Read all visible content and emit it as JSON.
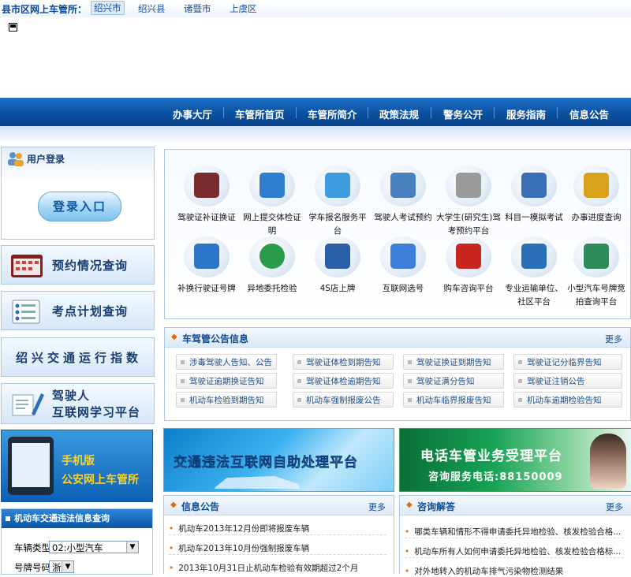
{
  "topbar": {
    "title": "县市区网上车管所：",
    "cities": [
      "绍兴市",
      "绍兴县",
      "诸暨市",
      "上虞区"
    ]
  },
  "nav": {
    "items": [
      "办事大厅",
      "车管所首页",
      "车管所简介",
      "政策法规",
      "警务公开",
      "服务指南",
      "信息公告"
    ]
  },
  "login": {
    "heading": "用户登录",
    "button": "登录入口"
  },
  "side_buttons": {
    "appointment": "预约情况查询",
    "exam_plan": "考点计划查询",
    "traffic_index": "绍兴交通运行指数",
    "learning_line1": "驾驶人",
    "learning_line2": "互联网学习平台"
  },
  "mobile": {
    "line1": "手机版",
    "line2": "公安网上车管所"
  },
  "violation": {
    "heading": "机动车交通违法信息查询",
    "type_label": "车辆类型",
    "type_value": "02:小型汽车",
    "plate_label": "号牌号码",
    "plate_value": "浙"
  },
  "services": [
    {
      "label": "驾驶证补证换证",
      "icon": "license-card-icon",
      "color": "#7a2b2b"
    },
    {
      "label": "网上提交体检证明",
      "icon": "documents-icon",
      "color": "#2f7fd0"
    },
    {
      "label": "学车报名服务平台",
      "icon": "pen-form-icon",
      "color": "#3f9be0"
    },
    {
      "label": "驾驶人考试预约",
      "icon": "monitor-icon",
      "color": "#4a7fc0"
    },
    {
      "label": "大学生(研究生)驾考预约平台",
      "icon": "book-icon",
      "color": "#9a9a9a"
    },
    {
      "label": "科目一模拟考试",
      "icon": "laptop-icon",
      "color": "#3a6fb5"
    },
    {
      "label": "办事进度查询",
      "icon": "folder-icon",
      "color": "#d9a21b"
    },
    {
      "label": "补换行驶证号牌",
      "icon": "blue-folder-icon",
      "color": "#2c76c9"
    },
    {
      "label": "异地委托检验",
      "icon": "globe-icon",
      "color": "#2a9b4a"
    },
    {
      "label": "4S店上牌",
      "icon": "calendar-icon",
      "color": "#2a5fa8"
    },
    {
      "label": "互联网选号",
      "icon": "palette-icon",
      "color": "#3c7fd8"
    },
    {
      "label": "购车咨询平台",
      "icon": "car-icon",
      "color": "#c8261f"
    },
    {
      "label": "专业运输单位、社区平台",
      "icon": "computer-icon",
      "color": "#2b6fb8"
    },
    {
      "label": "小型汽车号牌竞拍查询平台",
      "icon": "network-icon",
      "color": "#2f8a5a"
    }
  ],
  "notices": {
    "heading": "车驾管公告信息",
    "more": "更多",
    "tags": [
      "涉毒驾驶人告知、公告",
      "驾驶证体检到期告知",
      "驾驶证换证到期告知",
      "驾驶证记分临界告知",
      "驾驶证逾期换证告知",
      "驾驶证体检逾期告知",
      "驾驶证满分告知",
      "驾驶证注销公告",
      "机动车检验到期告知",
      "机动车强制报废公告",
      "机动车临界报废告知",
      "机动车逾期检验告知"
    ]
  },
  "banners": {
    "self_service": "交通违法互联网自助处理平台",
    "phone_title": "电话车管业务受理平台",
    "phone_number": "咨询服务电话:88150009"
  },
  "info": {
    "heading": "信息公告",
    "more": "更多",
    "items": [
      "机动车2013年12月份即将报废车辆",
      "机动车2013年10月份强制报废车辆",
      "2013年10月31日止机动车检验有效期超过2个月"
    ]
  },
  "consult": {
    "heading": "咨询解答",
    "more": "更多",
    "items": [
      "哪类车辆和情形不得申请委托异地检验、核发检验合格...",
      "机动车所有人如何申请委托异地检验、核发检验合格标...",
      "对外地转入的机动车排气污染物检测结果"
    ]
  }
}
